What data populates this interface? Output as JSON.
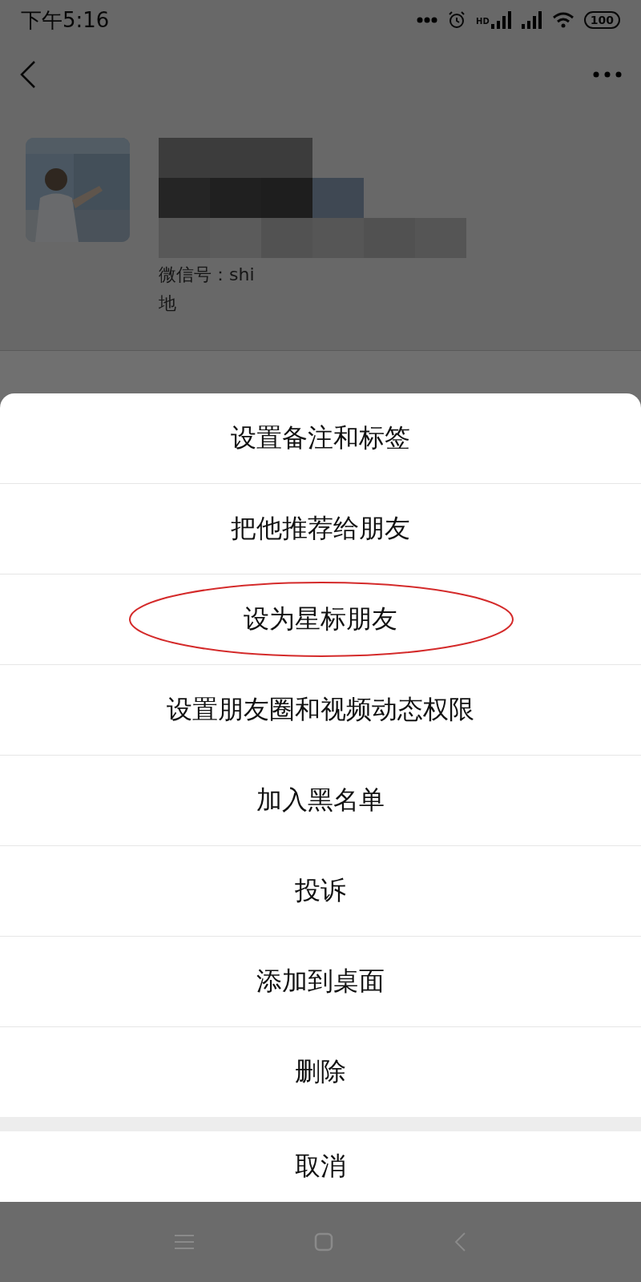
{
  "status_bar": {
    "time": "下午5:16",
    "network": "HD",
    "battery": "100"
  },
  "profile": {
    "wechat_id": "微信号：shi",
    "region": "地"
  },
  "action_sheet": {
    "items": [
      {
        "label": "设置备注和标签",
        "circled": false
      },
      {
        "label": "把他推荐给朋友",
        "circled": false
      },
      {
        "label": "设为星标朋友",
        "circled": true
      },
      {
        "label": "设置朋友圈和视频动态权限",
        "circled": false
      },
      {
        "label": "加入黑名单",
        "circled": false
      },
      {
        "label": "投诉",
        "circled": false
      },
      {
        "label": "添加到桌面",
        "circled": false
      },
      {
        "label": "删除",
        "circled": false
      }
    ],
    "cancel": "取消"
  }
}
